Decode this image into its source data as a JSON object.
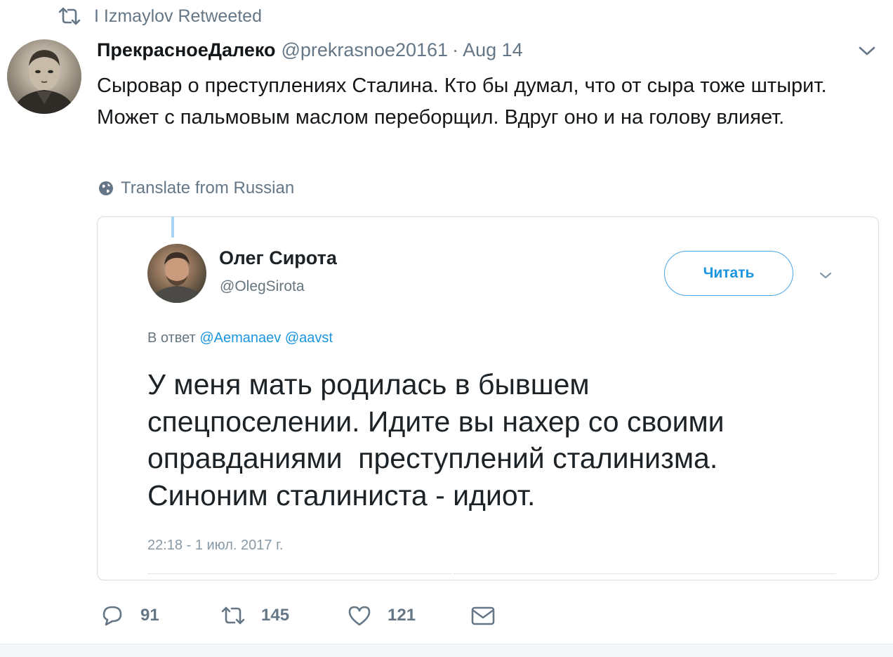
{
  "retweet_context": {
    "text": "I Izmaylov Retweeted",
    "icon": "retweet-icon"
  },
  "tweet": {
    "author_name": "ПрекрасноеДалеко",
    "author_handle": "@prekrasnoe20161",
    "separator": "·",
    "date": "Aug 14",
    "text": "Сыровар о преступлениях Сталина. Кто бы думал, что от сыра тоже штырит. Может с пальмовым маслом переборщил. Вдруг оно и на голову влияет.",
    "translate_label": "Translate from Russian"
  },
  "quoted_tweet": {
    "author_name": "Олег Сирота",
    "author_handle": "@OlegSirota",
    "follow_label": "Читать",
    "reply_prefix": "В ответ",
    "reply_mentions": [
      "@Aemanaev",
      "@aavst"
    ],
    "text": "У меня мать родилась в бывшем\nспецпоселении. Идите вы нахер со своими\nоправданиями  преступлений сталинизма.\nСиноним сталиниста - идиот.",
    "timestamp": "22:18 - 1 июл. 2017 г."
  },
  "actions": {
    "reply_count": "91",
    "retweet_count": "145",
    "like_count": "121"
  },
  "colors": {
    "text_primary": "#14171a",
    "text_secondary": "#657786",
    "link_blue": "#1b95e0",
    "border": "#d8dee3"
  }
}
